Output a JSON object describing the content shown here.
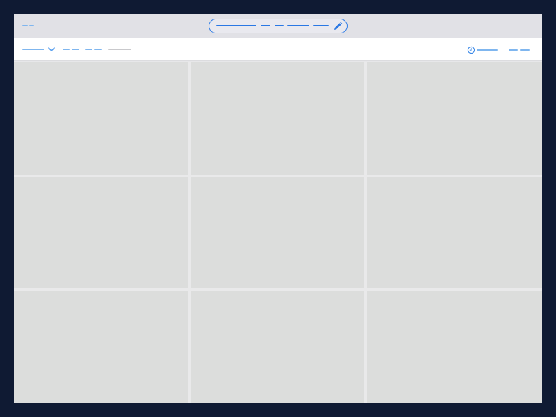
{
  "colors": {
    "frame": "#0f1a33",
    "accent": "#2a78e4",
    "accent_light": "#7fb6ef",
    "tile": "#dcdddc",
    "toolbar_bg": "#ffffff",
    "topbar_bg": "#e1e1e6"
  },
  "topbar": {
    "menu_icon": "menu-dashes-icon",
    "title_pill": {
      "edit_icon": "pencil-icon"
    }
  },
  "toolbar": {
    "dropdown_icon": "chevron-down-icon",
    "time_icon": "clock-icon"
  },
  "grid": {
    "columns": 3,
    "rows": 3,
    "tiles": [
      {
        "id": "tile-1"
      },
      {
        "id": "tile-2"
      },
      {
        "id": "tile-3"
      },
      {
        "id": "tile-4"
      },
      {
        "id": "tile-5"
      },
      {
        "id": "tile-6"
      },
      {
        "id": "tile-7"
      },
      {
        "id": "tile-8"
      },
      {
        "id": "tile-9"
      }
    ]
  }
}
